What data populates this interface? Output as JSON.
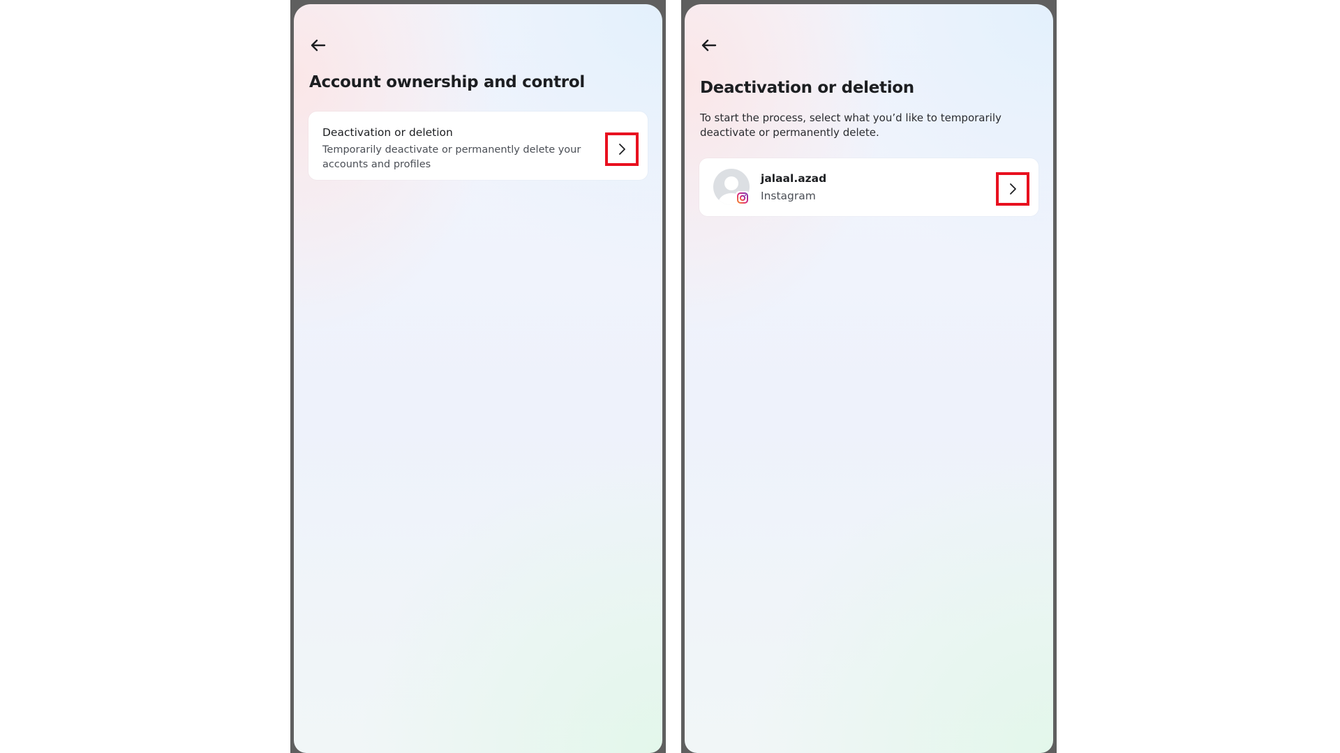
{
  "left_screen": {
    "title": "Account ownership and control",
    "option": {
      "title": "Deactivation or deletion",
      "subtitle": "Temporarily deactivate or permanently delete your accounts and profiles"
    }
  },
  "right_screen": {
    "title": "Deactivation or deletion",
    "description": "To start the process, select what you’d like to temporarily deactivate or permanently delete.",
    "account": {
      "username": "jalaal.azad",
      "platform": "Instagram"
    }
  },
  "icons": {
    "back": "arrow-left-icon",
    "next": "chevron-right-icon",
    "avatar": "default-avatar-icon",
    "platform_badge": "instagram-icon"
  },
  "colors": {
    "highlight": "#e8101f",
    "frame": "#5f5f5f",
    "text_primary": "#1c1e21",
    "text_secondary": "#4b4f56"
  }
}
